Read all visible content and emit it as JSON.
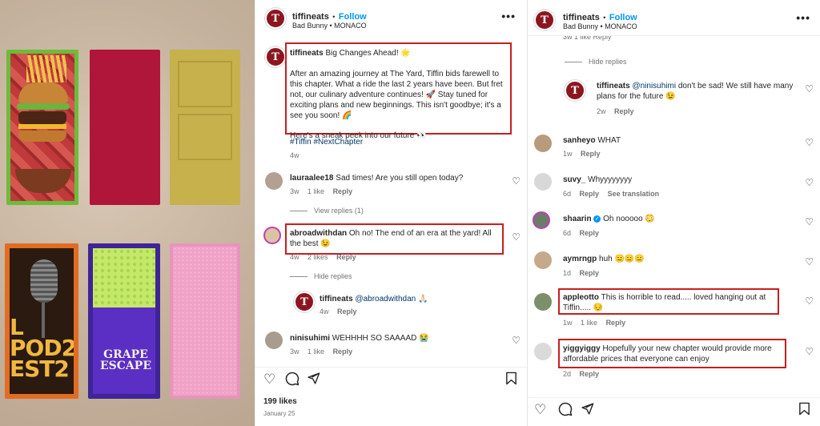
{
  "post_image": {
    "pod_text": "L POD2 EST2",
    "grape_text": "GRAPE ESCAPE"
  },
  "middle": {
    "header": {
      "username": "tiffineats",
      "dot": "•",
      "follow": "Follow",
      "subtitle": "Bad Bunny • MONACO",
      "more": "•••"
    },
    "caption": {
      "username": "tiffineats",
      "title": "Big Changes Ahead! 🌟",
      "body": "After an amazing journey at The Yard, Tiffin bids farewell to this chapter. What a ride the last 2 years have been. But fret not, our culinary adventure continues! 🚀 Stay tuned for exciting plans and new beginnings. This isn't goodbye; it's a see you soon! 🌈",
      "peek": "Here's a sneak peek into our future 👀",
      "hashtags": "#Tiffin #NextChapter",
      "age": "4w"
    },
    "comments": [
      {
        "username": "lauraalee18",
        "text": "Sad times! Are you still open today?",
        "age": "3w",
        "likes": "1 like",
        "reply": "Reply",
        "view_replies": "View replies (1)"
      },
      {
        "username": "abroadwithdan",
        "text": "Oh no! The end of an era at the yard! All the best 😉",
        "age": "4w",
        "likes": "2 likes",
        "reply": "Reply",
        "hide_replies": "Hide replies"
      },
      {
        "username": "tiffineats",
        "mention": "@abroadwithdan",
        "text": "🙏🏻",
        "age": "4w",
        "reply": "Reply"
      },
      {
        "username": "ninisuhimi",
        "text": "WEHHHH SO SAAAAD 😭",
        "age": "3w",
        "likes": "1 like",
        "reply": "Reply"
      }
    ],
    "likes_count": "199 likes",
    "date": "January 25"
  },
  "right": {
    "header": {
      "username": "tiffineats",
      "dot": "•",
      "follow": "Follow",
      "subtitle": "Bad Bunny • MONACO",
      "more": "•••"
    },
    "top_fragment": "3w   1 like   Reply",
    "hide_replies": "Hide replies",
    "reply": {
      "username": "tiffineats",
      "mention": "@ninisuhimi",
      "text": "don't be sad! We still have many plans for the future 😉",
      "age": "2w",
      "reply": "Reply"
    },
    "comments": [
      {
        "username": "sanheyo",
        "text": "WHAT",
        "age": "1w",
        "likes": "",
        "reply": "Reply",
        "extra": ""
      },
      {
        "username": "suvy_",
        "text": "Whyyyyyyyy",
        "age": "6d",
        "likes": "",
        "reply": "Reply",
        "extra": "See translation"
      },
      {
        "username": "shaarin",
        "text": "Oh nooooo 😳",
        "age": "6d",
        "likes": "",
        "reply": "Reply",
        "extra": ""
      },
      {
        "username": "aymrngp",
        "text": "huh 😑😑😑",
        "age": "1d",
        "likes": "",
        "reply": "Reply",
        "extra": ""
      },
      {
        "username": "appleotto",
        "text": "This is horrible to read..... loved hanging out at Tiffin..... 😔",
        "age": "1w",
        "likes": "1 like",
        "reply": "Reply",
        "extra": ""
      },
      {
        "username": "yiggyiggy",
        "text": "Hopefully your new chapter would provide more affordable prices that everyone can enjoy",
        "age": "2d",
        "likes": "",
        "reply": "Reply",
        "extra": ""
      }
    ]
  },
  "colors": {
    "highlight_box": "#c81e1e",
    "brand_avatar": "#8c1620",
    "follow_blue": "#0095f6"
  },
  "icons": [
    "heart-icon",
    "comment-icon",
    "share-icon",
    "bookmark-icon",
    "more-icon",
    "verified-icon"
  ]
}
